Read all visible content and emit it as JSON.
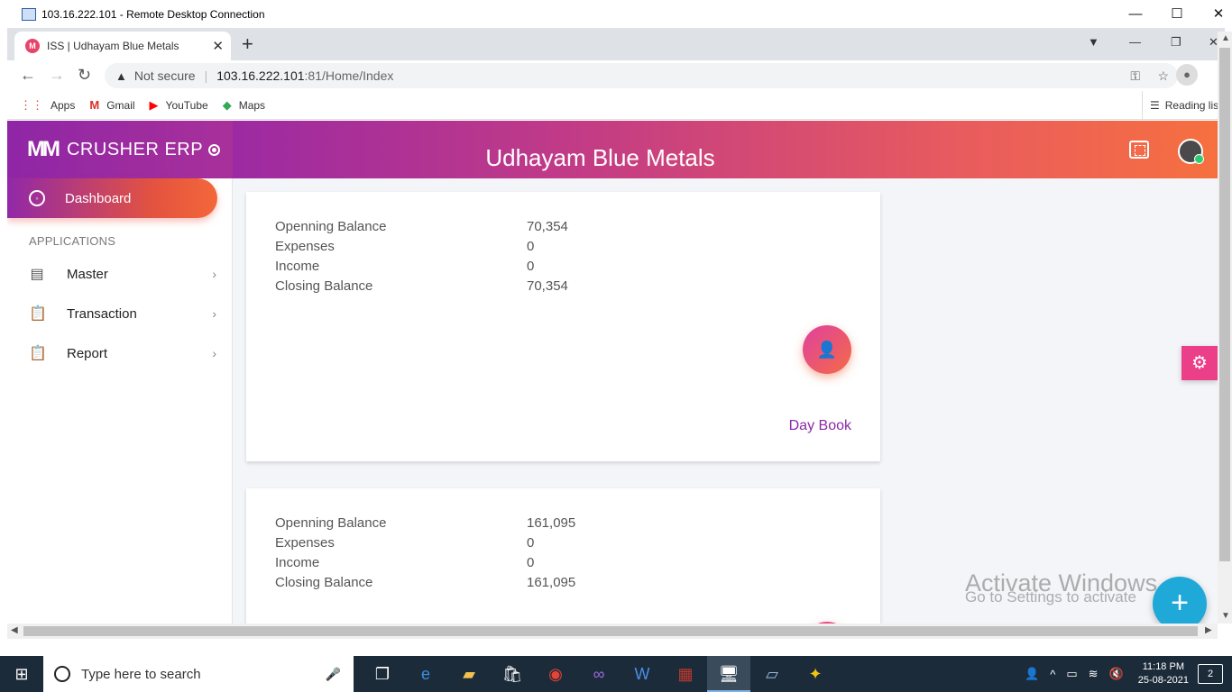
{
  "rdp": {
    "title": "103.16.222.101 - Remote Desktop Connection",
    "min": "—",
    "max": "☐",
    "close": "✕"
  },
  "browser": {
    "tab_title": "ISS | Udhayam Blue Metals",
    "tab_close": "✕",
    "new_tab": "+",
    "not_secure": "Not secure",
    "url_host": "103.16.222.101",
    "url_path": ":81/Home/Index",
    "bookmarks": [
      {
        "label": "Apps",
        "icon": "apps-grid-icon"
      },
      {
        "label": "Gmail",
        "icon": "gmail-icon"
      },
      {
        "label": "YouTube",
        "icon": "youtube-icon"
      },
      {
        "label": "Maps",
        "icon": "maps-icon"
      }
    ],
    "reading_list": "Reading list"
  },
  "app": {
    "brand": "CRUSHER ERP",
    "header_title": "Udhayam Blue Metals",
    "sidebar": {
      "active": "Dashboard",
      "section_label": "APPLICATIONS",
      "items": [
        {
          "label": "Master",
          "icon": "list-icon"
        },
        {
          "label": "Transaction",
          "icon": "clipboard-icon"
        },
        {
          "label": "Report",
          "icon": "clipboard-icon"
        }
      ]
    },
    "cards": [
      {
        "rows": [
          {
            "label": "Openning Balance",
            "value": "70,354"
          },
          {
            "label": "Expenses",
            "value": "0"
          },
          {
            "label": "Income",
            "value": "0"
          },
          {
            "label": "Closing Balance",
            "value": "70,354"
          }
        ],
        "link": "Day Book"
      },
      {
        "rows": [
          {
            "label": "Openning Balance",
            "value": "161,095"
          },
          {
            "label": "Expenses",
            "value": "0"
          },
          {
            "label": "Income",
            "value": "0"
          },
          {
            "label": "Closing Balance",
            "value": "161,095"
          }
        ]
      }
    ],
    "watermark": {
      "line1": "Activate Windows",
      "line2": "Go to Settings to activate"
    }
  },
  "taskbar": {
    "search_placeholder": "Type here to search",
    "time": "11:18 PM",
    "date": "25-08-2021",
    "notifications": "2"
  },
  "colors": {
    "header_start": "#9c2aa2",
    "header_end": "#f6703f",
    "link": "#8a2aa8",
    "fab_add": "#1fa9d8"
  }
}
